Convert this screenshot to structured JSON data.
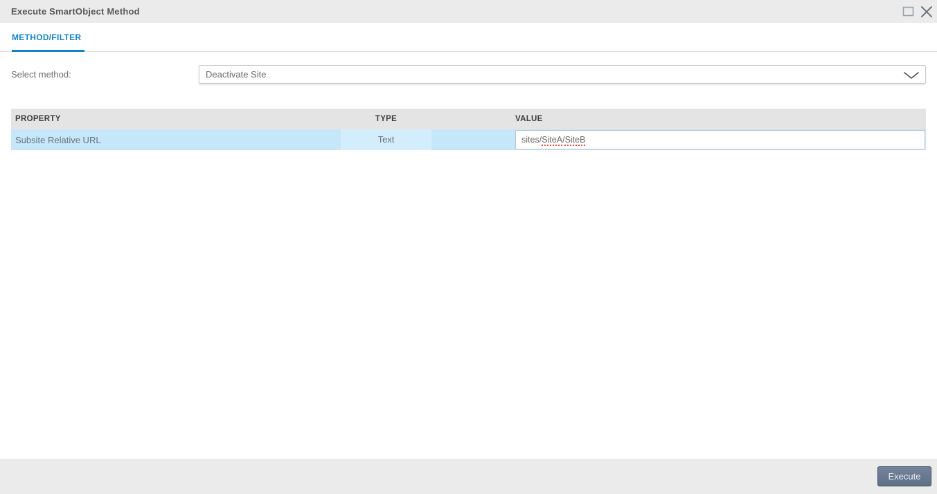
{
  "dialog": {
    "title": "Execute SmartObject Method",
    "window_controls": {
      "maximize_icon": "maximize-window-icon",
      "close_icon": "close-icon"
    },
    "tabs": [
      {
        "label": "METHOD/FILTER",
        "active": true
      }
    ],
    "method": {
      "label": "Select method:",
      "selected": "Deactivate Site",
      "dropdown_icon": "chevron-down-icon"
    },
    "table": {
      "columns": [
        "PROPERTY",
        "TYPE",
        "VALUE"
      ],
      "rows": [
        {
          "property": "Subsite Relative URL",
          "type": "Text",
          "value": "sites/SiteA/SiteB",
          "value_parts": {
            "prefix": "sites/",
            "word1": "SiteA",
            "sep": "/",
            "word2": "SiteB"
          },
          "spellcheck_flagged": [
            "SiteA",
            "SiteB"
          ],
          "selected": true
        }
      ]
    },
    "footer": {
      "execute_label": "Execute"
    }
  },
  "colors": {
    "accent_blue": "#1583c7",
    "titlebar_bg": "#ebebeb",
    "footer_bg": "#ebebeb",
    "header_bg": "#e4e4e4",
    "row_highlight": "#c6e7fa",
    "row_highlight_light": "#d4edfc",
    "button_bg": "#66788e",
    "spellcheck_red": "#e0503c"
  }
}
